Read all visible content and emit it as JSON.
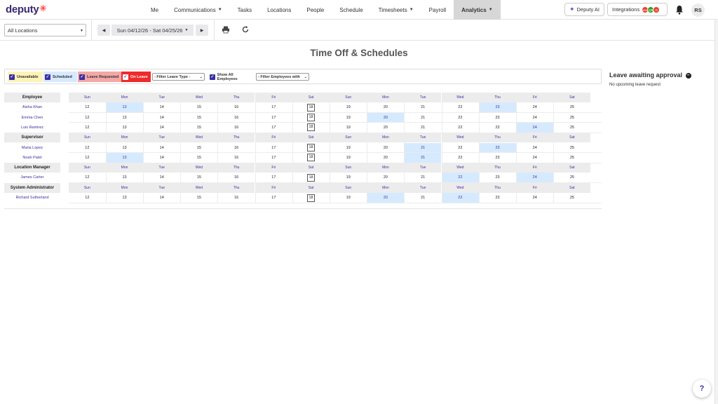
{
  "app": {
    "logo": "deputy"
  },
  "nav": {
    "items": [
      {
        "label": "Me",
        "caret": false
      },
      {
        "label": "Communications",
        "caret": true
      },
      {
        "label": "Tasks",
        "caret": false
      },
      {
        "label": "Locations",
        "caret": false
      },
      {
        "label": "People",
        "caret": false
      },
      {
        "label": "Schedule",
        "caret": false
      },
      {
        "label": "Timesheets",
        "caret": true
      },
      {
        "label": "Payroll",
        "caret": false
      },
      {
        "label": "Analytics",
        "caret": true,
        "active": true
      }
    ],
    "deputy_ai": "Deputy AI",
    "integrations": "Integrations",
    "integration_dots": [
      {
        "text": "xero",
        "color": "#e8442c"
      },
      {
        "text": "QB",
        "color": "#2ca01c"
      },
      {
        "text": "G",
        "color": "#e8442c"
      }
    ],
    "avatar": "RS"
  },
  "toolbar": {
    "location": "All Locations",
    "date_range": "Sun 04/12/26 - Sat 04/25/26"
  },
  "page": {
    "title": "Time Off & Schedules"
  },
  "filters": {
    "unavailable": "Unavailable",
    "scheduled": "Scheduled",
    "leave_requested": "Leave Requested",
    "on_leave": "On Leave",
    "leave_type": "- Filter Leave Type -",
    "show_all": "Show All Employees",
    "employees_with": "- Filter Employees with"
  },
  "leave_panel": {
    "title": "Leave awaiting approval",
    "empty": "No upcoming leave request"
  },
  "grid": {
    "weekdays": [
      "Sun",
      "Mon",
      "Tue",
      "Wed",
      "Thu",
      "Fri",
      "Sat",
      "Sun",
      "Mon",
      "Tue",
      "Wed",
      "Thu",
      "Fri",
      "Sat"
    ],
    "dates": [
      "12",
      "13",
      "14",
      "15",
      "16",
      "17",
      "18",
      "19",
      "20",
      "21",
      "22",
      "23",
      "24",
      "25"
    ],
    "today_index": 6,
    "groups": [
      {
        "name": "Employee",
        "employees": [
          {
            "name": "Aisha Khan",
            "leave": [
              1,
              11
            ]
          },
          {
            "name": "Emma Chen",
            "leave": [
              8
            ]
          },
          {
            "name": "Luis Ramirez",
            "leave": [
              12
            ]
          }
        ]
      },
      {
        "name": "Supervisor",
        "employees": [
          {
            "name": "Maria Lopez",
            "leave": [
              9,
              11
            ]
          },
          {
            "name": "Noah Patel",
            "leave": [
              1,
              9
            ]
          }
        ]
      },
      {
        "name": "Location Manager",
        "employees": [
          {
            "name": "James Carter",
            "leave": [
              10,
              12
            ]
          }
        ]
      },
      {
        "name": "System Administrator",
        "employees": [
          {
            "name": "Richard Sutherland",
            "leave": [
              8,
              10
            ]
          }
        ]
      }
    ]
  },
  "colors": {
    "leave_cell": "#d6eaff",
    "unavailable_chip": "#fdf3b8",
    "scheduled_chip": "#d6eaff",
    "leave_requested_chip": "#f4a7a7",
    "on_leave_chip": "#ee2a2a",
    "accent": "#3b2fa0"
  }
}
